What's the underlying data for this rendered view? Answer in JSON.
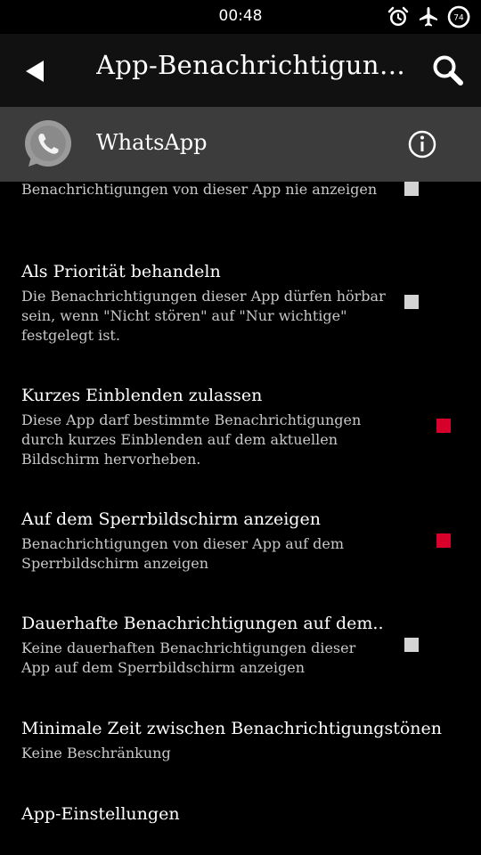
{
  "status_bar": {
    "time": "00:48",
    "battery_level": "74",
    "icons": [
      "alarm-icon",
      "airplane-icon",
      "battery-icon"
    ]
  },
  "toolbar": {
    "title": "App-Benachrichtigung…",
    "back_icon": "back-arrow-icon",
    "search_icon": "search-icon"
  },
  "app_header": {
    "app_name": "WhatsApp",
    "app_icon": "whatsapp-icon",
    "info_icon": "info-icon"
  },
  "settings": [
    {
      "title": "",
      "subtitle": "Benachrichtigungen von dieser App nie anzeigen",
      "checked": false
    },
    {
      "title": "Als Priorität behandeln",
      "subtitle": "Die Benachrichtigungen dieser App dürfen hörbar sein, wenn \"Nicht stören\" auf \"Nur wichtige\" festgelegt ist.",
      "checked": false
    },
    {
      "title": "Kurzes Einblenden zulassen",
      "subtitle": "Diese App darf bestimmte Benachrichtigungen durch kurzes Einblenden auf dem aktuellen Bildschirm hervorheben.",
      "checked": true
    },
    {
      "title": "Auf dem Sperrbildschirm anzeigen",
      "subtitle": "Benachrichtigungen von dieser App auf dem Sperrbildschirm anzeigen",
      "checked": true
    },
    {
      "title": "Dauerhafte Benachrichtigungen auf dem..",
      "subtitle": "Keine dauerhaften Benachrichtigungen dieser App auf dem Sperrbildschirm anzeigen",
      "checked": false
    },
    {
      "title": "Minimale Zeit zwischen Benachrichtigungstönen",
      "subtitle": "Keine Beschränkung"
    },
    {
      "title": "App-Einstellungen",
      "subtitle": ""
    }
  ],
  "colors": {
    "background": "#000000",
    "toolbar": "#111111",
    "app_header": "#3c3c3c",
    "checkbox_on": "#d6002a",
    "checkbox_off": "#d4d4d4",
    "subtitle_text": "#c8c8c8"
  }
}
